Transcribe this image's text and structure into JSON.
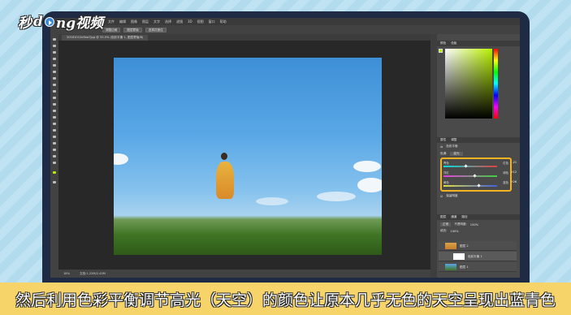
{
  "logo": {
    "part1": "秒",
    "part2": "d",
    "part3": "ng视频"
  },
  "menubar": [
    "PS",
    "文件",
    "编辑",
    "图像",
    "图层",
    "文字",
    "选择",
    "滤镜",
    "3D",
    "视图",
    "窗口",
    "帮助"
  ],
  "options": {
    "btn1": "调整边缘",
    "btn2": "图层蒙版",
    "btn3": "选择并遮住"
  },
  "document": {
    "tab_title": "20181012d5ea7jpg @ 33.5% (色彩平衡 1, 图层蒙版/8)"
  },
  "status": {
    "zoom": "18%",
    "doc": "文档:1.22M/2.43M"
  },
  "color_panel": {
    "tab1": "颜色",
    "tab2": "色板"
  },
  "properties_panel": {
    "tab1": "属性",
    "tab2": "调整",
    "title": "色彩平衡",
    "tone_label": "色调:",
    "tone_value": "高光",
    "sliders": [
      {
        "left": "青色",
        "right": "红色",
        "value": "-21"
      },
      {
        "left": "洋红",
        "right": "绿色",
        "value": "+12"
      },
      {
        "left": "黄色",
        "right": "蓝色",
        "value": "+26"
      }
    ],
    "preserve": "保留明度"
  },
  "layers_panel": {
    "tab1": "图层",
    "tab2": "通道",
    "tab3": "路径",
    "mode": "正常",
    "opacity_label": "不透明度:",
    "opacity": "100%",
    "fill_label": "填充:",
    "fill": "100%",
    "layers": [
      {
        "name": "图层 2"
      },
      {
        "name": "色彩平衡 1"
      },
      {
        "name": "图层 1"
      }
    ]
  },
  "caption": "然后利用色彩平衡调节高光（天空）的颜色让原本几乎无色的天空呈现出蓝青色",
  "colors": {
    "accent": "#f4b321",
    "caption_bg": "#f6d46a",
    "frame": "#1f2a44"
  }
}
